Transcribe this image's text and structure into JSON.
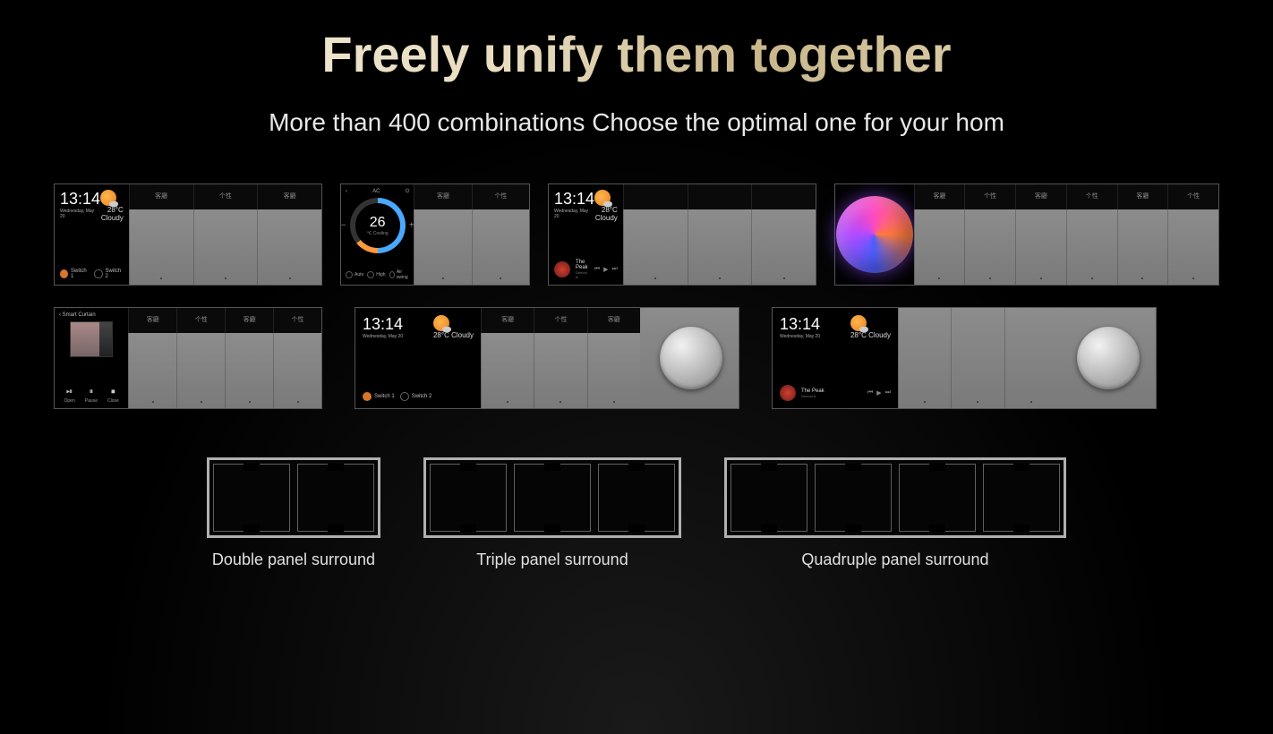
{
  "title": "Freely unify them together",
  "subtitle": "More than 400 combinations Choose the optimal one for your hom",
  "clock": {
    "time": "13:14",
    "date": "Wednesday, May 20",
    "temp": "28°C",
    "cond": "Cloudy"
  },
  "switches": {
    "s1": "Switch 1",
    "s2": "Switch 2"
  },
  "ac": {
    "label": "AC",
    "value": "26",
    "auto": "Auto",
    "high": "High",
    "swing": "Air swing"
  },
  "track": {
    "name": "The Peak",
    "artist": "Demon A"
  },
  "curtain": {
    "title": "Smart Curtain",
    "open": "Open",
    "pause": "Pause",
    "close": "Close"
  },
  "sw_labels": {
    "a": "客廳",
    "b": "个性",
    "c": "客廳",
    "d": "个性",
    "e": "客廳",
    "f": "个性"
  },
  "frames": {
    "double": "Double panel surround",
    "triple": "Triple panel surround",
    "quad": "Quadruple panel surround"
  }
}
